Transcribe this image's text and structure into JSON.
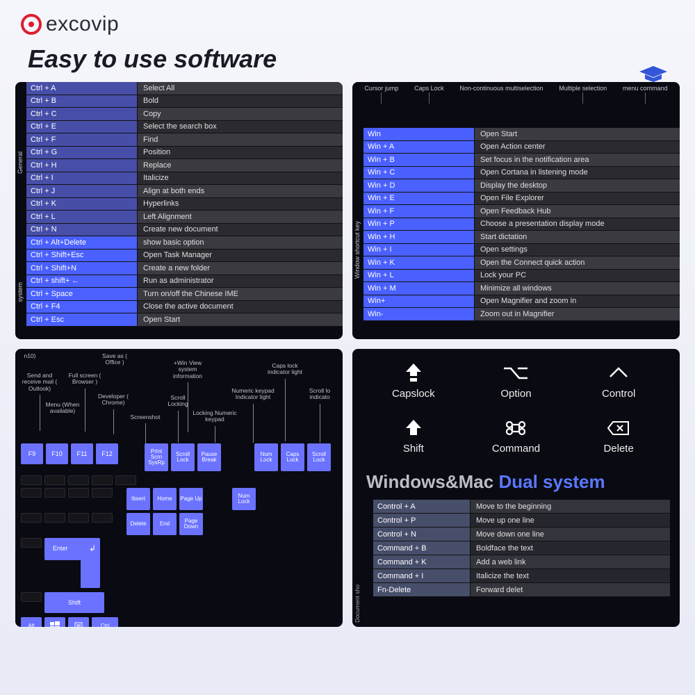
{
  "brand": "excovip",
  "tagline": "Easy to use software",
  "panel1": {
    "label1": "General",
    "label2": "system",
    "general": [
      {
        "k": "Ctrl + A",
        "d": "Select All"
      },
      {
        "k": "Ctrl + B",
        "d": "Bold"
      },
      {
        "k": "Ctrl + C",
        "d": "Copy"
      },
      {
        "k": "Ctrl + E",
        "d": "Select the search box"
      },
      {
        "k": "Ctrl + F",
        "d": "Find"
      },
      {
        "k": "Ctrl + G",
        "d": "Position"
      },
      {
        "k": "Ctrl + H",
        "d": "Replace"
      },
      {
        "k": "Ctrl + I",
        "d": "Italicize"
      },
      {
        "k": "Ctrl + J",
        "d": "Align at both ends"
      },
      {
        "k": "Ctrl + K",
        "d": "Hyperlinks"
      },
      {
        "k": "Ctrl + L",
        "d": "Left Alignment"
      },
      {
        "k": "Ctrl + N",
        "d": "Create new document"
      }
    ],
    "system": [
      {
        "k": "Ctrl + Alt+Delete",
        "d": "show basic option"
      },
      {
        "k": "Ctrl + Shift+Esc",
        "d": "Open Task Manager"
      },
      {
        "k": "Ctrl + Shift+N",
        "d": "Create a new folder"
      },
      {
        "k": "Ctrl + shift+ ←",
        "d": "Run as administrator"
      },
      {
        "k": "Ctrl + Space",
        "d": "Turn on/off the Chinese IME"
      },
      {
        "k": "Ctrl + F4",
        "d": "Close the active document"
      },
      {
        "k": "Ctrl + Esc",
        "d": "Open Start"
      }
    ]
  },
  "panel2": {
    "header": {
      "a": "Cursor jump",
      "b": "Caps Lock",
      "c": "Multiple selection",
      "d": "menu command",
      "e": "Non-continuous multiselection"
    },
    "label": "Window shortcut key",
    "rows": [
      {
        "k": "Win",
        "d": "Open Start"
      },
      {
        "k": "Win + A",
        "d": "Open Action center"
      },
      {
        "k": "Win + B",
        "d": "Set focus in the notification area"
      },
      {
        "k": "Win + C",
        "d": "Open Cortana in listening mode"
      },
      {
        "k": "Win + D",
        "d": "Display the desktop"
      },
      {
        "k": "Win + E",
        "d": "Open File Explorer"
      },
      {
        "k": "Win + F",
        "d": "Open Feedback Hub"
      },
      {
        "k": "Win + P",
        "d": "Choose a presentation display mode"
      },
      {
        "k": "Win + H",
        "d": "Start dictation"
      },
      {
        "k": "Win + I",
        "d": "Open settings"
      },
      {
        "k": "Win + K",
        "d": "Open the Connect quick action"
      },
      {
        "k": "Win + L",
        "d": "Lock your PC"
      },
      {
        "k": "Win + M",
        "d": "Minimize all windows"
      },
      {
        "k": "Win+",
        "d": "Open Magnifier and zoom in"
      },
      {
        "k": "Win-",
        "d": "Zoom out in Magnifier"
      }
    ]
  },
  "panel3": {
    "anno": {
      "a10": "n10)",
      "sendmail": "Send and receive mail ( Outlook)",
      "menu": "Menu (When available)",
      "saveas": "Save as ( Office )",
      "fullscreen": "Full screen ( Browser )",
      "devchrome": "Developer ( Chrome)",
      "screenshot": "Screenshot",
      "winview": "+Win View system information",
      "scrolllocking": "Scroll Locking",
      "lockingnum": "Locking Numeric keypad",
      "numindic": "Numeric keypad Indicator light",
      "capsindic": "Caps lock indicator light",
      "scrollind": "Scroll lo indicato"
    },
    "keys": {
      "f9": "F9",
      "f10": "F10",
      "f11": "F11",
      "f12": "F12",
      "print": "Prlnt Scrn SysRp",
      "scrl": "Scroll Lock",
      "pause": "Pause Break",
      "num": "Num Lock",
      "caps": "Caps Lock",
      "scrl2": "Scroll Lock",
      "insert": "Ibsert",
      "home": "Home",
      "pgup": "Page Up",
      "numl2": "Num Lock",
      "del": "Delete",
      "end": "End",
      "pgdn": "Page Down",
      "enter": "Enter",
      "shift": "Shift",
      "alt": "Alt",
      "ctrl": "Ctrl"
    }
  },
  "panel4": {
    "symbols": [
      {
        "icon": "capslock",
        "label": "Capslock"
      },
      {
        "icon": "option",
        "label": "Option"
      },
      {
        "icon": "control",
        "label": "Control"
      },
      {
        "icon": "shift",
        "label": "Shift"
      },
      {
        "icon": "command",
        "label": "Command"
      },
      {
        "icon": "delete",
        "label": "Delete"
      }
    ],
    "title_a": "Windows&Mac",
    "title_b": "Dual system",
    "vlabel": "Document sho",
    "rows": [
      {
        "k": "Control + A",
        "d": "Move to the beginning"
      },
      {
        "k": "Control + P",
        "d": "Move up one line"
      },
      {
        "k": "Control + N",
        "d": "Move down one line"
      },
      {
        "k": "Command + B",
        "d": "Boldface the text"
      },
      {
        "k": "Command + K",
        "d": "Add a web link"
      },
      {
        "k": "Command + I",
        "d": "Italicize the text"
      },
      {
        "k": "Fn-Delete",
        "d": "Forward delet"
      }
    ]
  }
}
